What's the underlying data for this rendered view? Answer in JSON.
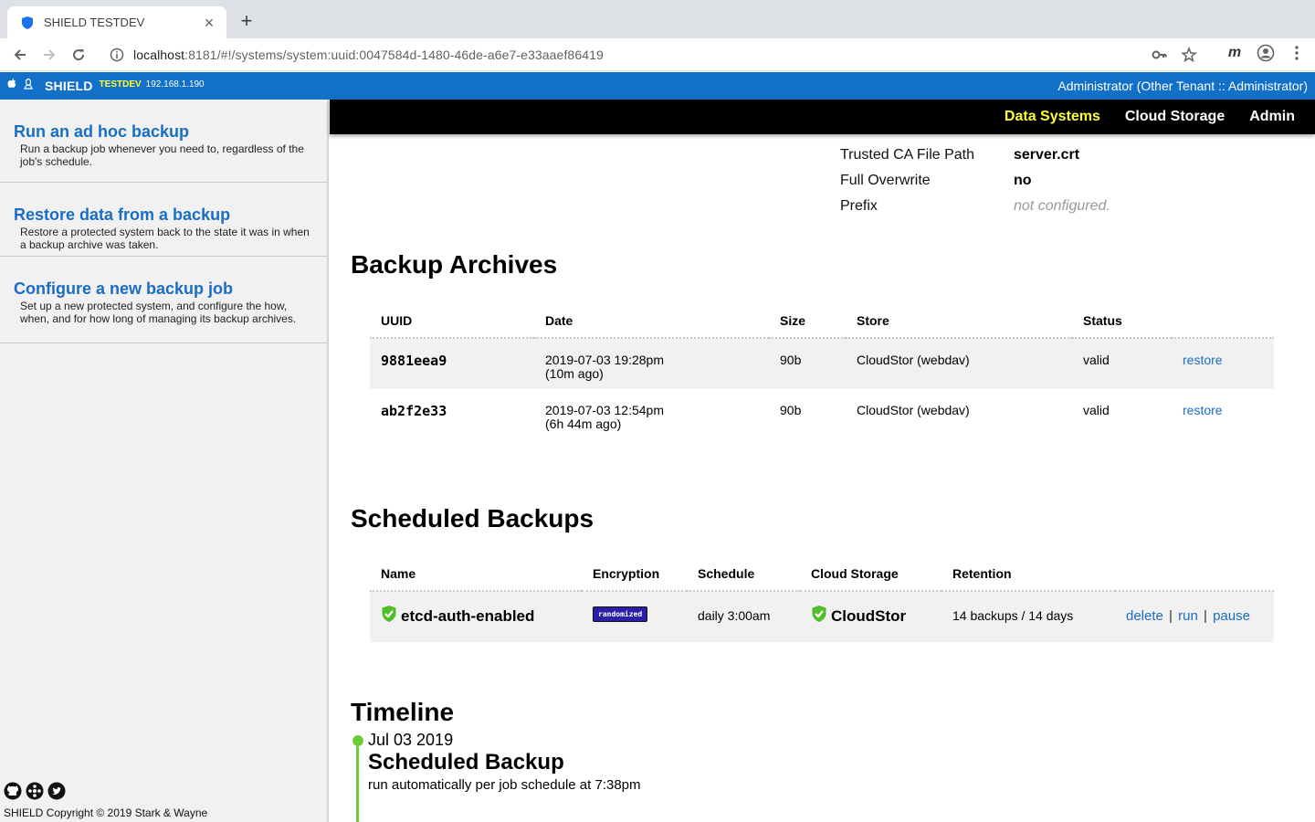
{
  "browser": {
    "tab_title": "SHIELD TESTDEV",
    "url_host": "localhost",
    "url_rest": ":8181/#!/systems/system:uuid:0047584d-1480-46de-a6e7-e33aaef86419"
  },
  "header": {
    "brand": "SHIELD",
    "env": "TESTDEV",
    "ip": "192.168.1.190",
    "user": "Administrator (Other Tenant :: Administrator)"
  },
  "sidebar": {
    "items": [
      {
        "title": "Run an ad hoc backup",
        "desc": "Run a backup job whenever you need to, regardless of the job's schedule."
      },
      {
        "title": "Restore data from a backup",
        "desc": "Restore a protected system back to the state it was in when a backup archive was taken."
      },
      {
        "title": "Configure a new backup job",
        "desc": "Set up a new protected system, and configure the how, when, and for how long of managing its backup archives."
      }
    ],
    "copyright": "SHIELD Copyright © 2019 Stark & Wayne"
  },
  "topnav": {
    "items": [
      "Data Systems",
      "Cloud Storage",
      "Admin"
    ]
  },
  "config": [
    {
      "key": "Trusted CA File Path",
      "value": "server.crt"
    },
    {
      "key": "Full Overwrite",
      "value": "no"
    },
    {
      "key": "Prefix",
      "value": "not configured."
    }
  ],
  "archives": {
    "heading": "Backup Archives",
    "columns": [
      "UUID",
      "Date",
      "Size",
      "Store",
      "Status"
    ],
    "rows": [
      {
        "uuid": "9881eea9",
        "date": "2019-07-03 19:28pm",
        "ago": "(10m ago)",
        "size": "90b",
        "store": "CloudStor (webdav)",
        "status": "valid",
        "action": "restore"
      },
      {
        "uuid": "ab2f2e33",
        "date": "2019-07-03 12:54pm",
        "ago": "(6h 44m ago)",
        "size": "90b",
        "store": "CloudStor (webdav)",
        "status": "valid",
        "action": "restore"
      }
    ]
  },
  "scheduled": {
    "heading": "Scheduled Backups",
    "columns": [
      "Name",
      "Encryption",
      "Schedule",
      "Cloud Storage",
      "Retention"
    ],
    "row": {
      "name": "etcd-auth-enabled",
      "encryption": "randomized",
      "schedule": "daily 3:00am",
      "storage": "CloudStor",
      "retention": "14 backups / 14 days",
      "actions": [
        "delete",
        "run",
        "pause"
      ],
      "separator": "|"
    }
  },
  "timeline": {
    "heading": "Timeline",
    "date": "Jul 03 2019",
    "title": "Scheduled Backup",
    "desc": "run automatically per job schedule at 7:38pm"
  },
  "colors": {
    "header_blue": "#1270c9",
    "link_blue": "#1a6dc5",
    "nav_active": "#ffff33",
    "timeline_green": "#6dcc3a",
    "badge_purple": "#2a1fa6"
  }
}
